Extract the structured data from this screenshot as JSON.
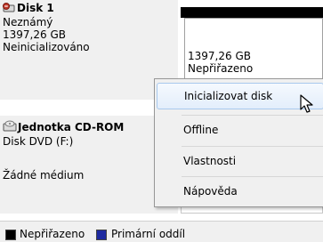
{
  "disk1": {
    "title": "Disk 1",
    "type": "Neznámý",
    "size": "1397,26 GB",
    "status": "Neinicializováno"
  },
  "volume": {
    "size": "1397,26 GB",
    "status": "Nepřiřazeno"
  },
  "cdrom": {
    "title": "Jednotka CD-ROM",
    "type": "Disk DVD (F:)",
    "status": "Žádné médium"
  },
  "context_menu": {
    "items": [
      {
        "label": "Inicializovat disk",
        "highlighted": true
      },
      {
        "label": "Offline"
      },
      {
        "label": "Vlastnosti"
      },
      {
        "label": "Nápověda"
      }
    ]
  },
  "legend": {
    "items": [
      {
        "label": "Nepřiřazeno",
        "color": "#000000"
      },
      {
        "label": "Primární oddíl",
        "color": "#1e2aa0"
      }
    ]
  },
  "colors": {
    "disk_icon": "#c0392b",
    "panel_bg": "#f0f0f0",
    "highlight_border": "#a8c9ee"
  }
}
